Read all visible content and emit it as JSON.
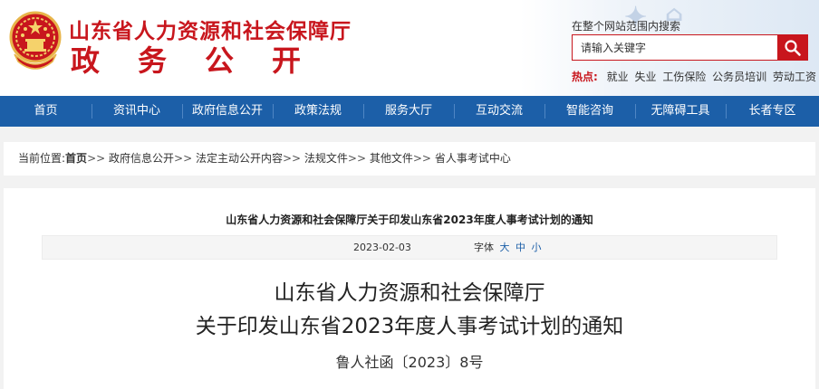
{
  "header": {
    "title": "山东省人力资源和社会保障厅",
    "subtitle": "政务公开"
  },
  "search": {
    "scope_label": "在整个网站范围内搜索",
    "placeholder": "请输入关键字"
  },
  "hot": {
    "label": "热点:",
    "items": [
      "就业",
      "失业",
      "工伤保险",
      "公务员培训",
      "劳动工资"
    ]
  },
  "nav": {
    "items": [
      "首页",
      "资讯中心",
      "政府信息公开",
      "政策法规",
      "服务大厅",
      "互动交流",
      "智能咨询",
      "无障碍工具",
      "长者专区"
    ]
  },
  "breadcrumb": {
    "prefix": "当前位置:",
    "items": [
      "首页",
      "政府信息公开",
      "法定主动公开内容",
      "法规文件",
      "其他文件",
      "省人事考试中心"
    ],
    "separator": ">>"
  },
  "article": {
    "heading": "山东省人力资源和社会保障厅关于印发山东省2023年度人事考试计划的通知",
    "date": "2023-02-03",
    "font_label": "字体",
    "font_sizes": [
      "大",
      "中",
      "小"
    ],
    "doc_title_line1": "山东省人力资源和社会保障厅",
    "doc_title_line2": "关于印发山东省2023年度人事考试计划的通知",
    "doc_number": "鲁人社函〔2023〕8号"
  },
  "colors": {
    "brand_red": "#c8161d",
    "nav_blue": "#1c5fa8"
  }
}
